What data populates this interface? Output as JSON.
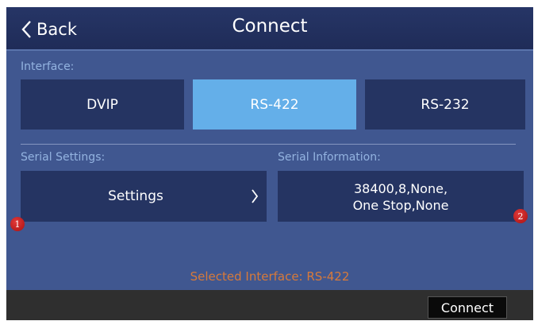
{
  "header": {
    "back_label": "Back",
    "title": "Connect"
  },
  "interface": {
    "label": "Interface:",
    "options": [
      "DVIP",
      "RS-422",
      "RS-232"
    ],
    "selected": "RS-422"
  },
  "serial_settings": {
    "label": "Serial Settings:",
    "button_label": "Settings"
  },
  "serial_information": {
    "label": "Serial Information:",
    "line1": "38400,8,None,",
    "line2": "One Stop,None"
  },
  "markers": [
    "1",
    "2"
  ],
  "status": "Selected Interface: RS-422",
  "footer": {
    "connect_label": "Connect"
  },
  "colors": {
    "selected": "#64afe9",
    "status_text": "#d77a3a",
    "marker": "#c81e1e"
  }
}
